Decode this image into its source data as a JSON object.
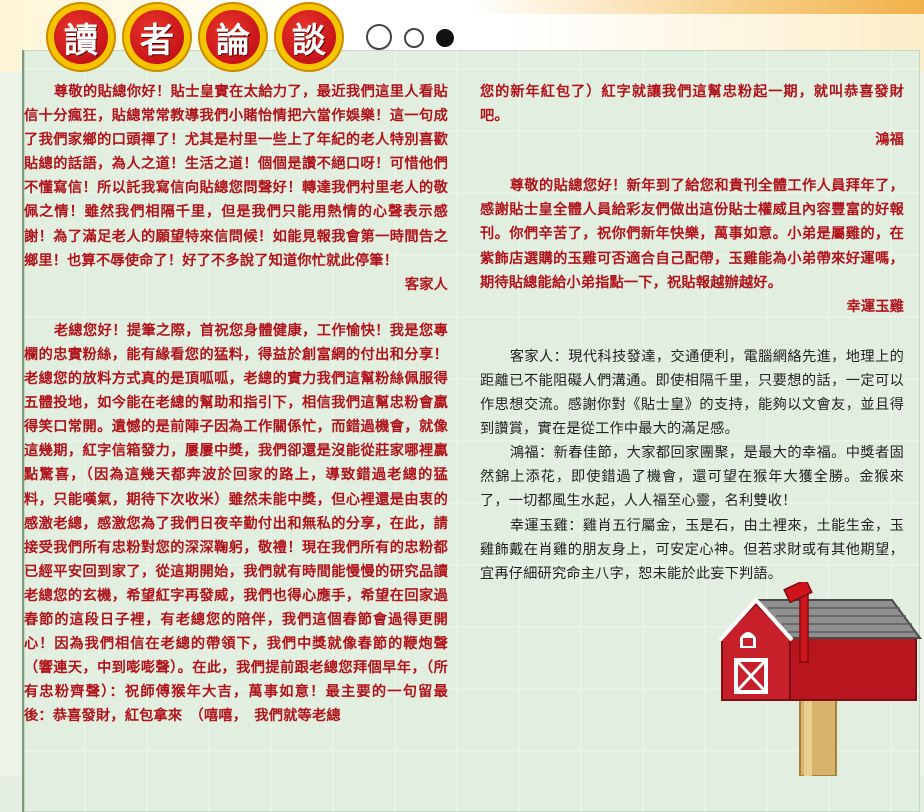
{
  "header": {
    "title_chars": [
      "讀",
      "者",
      "論",
      "談"
    ]
  },
  "colors": {
    "letter_text": "#b0141a",
    "reply_text": "#222222",
    "badge_red": "#c8141a",
    "badge_ring": "#f5c400",
    "background": "#e2efe0"
  },
  "letters_left": {
    "letter1": {
      "text": "尊敬的貼總你好！貼士皇實在太給力了，最近我們這里人看貼信十分瘋狂，貼總常常教導我們小賭怡情把六當作娛樂！這一句成了我們家鄉的口頭禪了！尤其是村里一些上了年紀的老人特別喜歡貼總的話語，為人之道！生活之道！個個是讚不絕口呀！可惜他們不懂寫信！所以託我寫信向貼總您問聲好！轉達我們村里老人的敬佩之情！雖然我們相隔千里，但是我們只能用熱情的心聲表示感謝！為了滿足老人的願望特來信問候！如能見報我會第一時間告之鄉里！也算不辱使命了！好了不多說了知道你忙就此停筆！",
      "signature": "客家人"
    },
    "letter2": {
      "text": "老總您好！提筆之際，首祝您身體健康，工作愉快！我是您專欄的忠實粉絲，能有緣看您的猛料，得益於創富網的付出和分享！老總您的放料方式真的是頂呱呱，老總的實力我們這幫粉絲佩服得五體投地，如今能在老總的幫助和指引下，相信我們這幫忠粉會贏得笑口常開。遺憾的是前陣子因為工作關係忙，而錯過機會，就像這幾期，紅字信箱發力，屢屢中獎，我們卻還是沒能從莊家哪裡贏點驚喜，（因為這幾天都奔波於回家的路上，導致錯過老總的猛料，只能嘆氣，期待下次收米）雖然未能中獎，但心裡還是由衷的感激老總，感激您為了我們日夜辛勤付出和無私的分享，在此，請接受我們所有忠粉對您的深深鞠躬，敬禮！現在我們所有的忠粉都已經平安回到家了，從這期開始，我們就有時間能慢慢的研究品讀老總您的玄機，希望紅字再發威，我們也得心應手，希望在回家過春節的這段日子裡，有老總您的陪伴，我們這個春節會過得更開心！因為我們相信在老總的帶領下，我們中獎就像春節的鞭炮聲（響連天，中到嘭嘭聲）。在此，我們提前跟老總您拜個早年，（所有忠粉齊聲）：祝師傅猴年大吉，萬事如意！最主要的一句留最後：恭喜發財，紅包拿來　（嘻嘻，　我們就等老總"
    }
  },
  "letters_right": {
    "letter2_continued": "您的新年紅包了）紅字就讓我們這幫忠粉起一期，就叫恭喜發財吧。",
    "letter2_signature": "鴻福",
    "letter3": {
      "text": "尊敬的貼總您好！新年到了給您和貴刊全體工作人員拜年了，感謝貼士皇全體人員給彩友們做出這份貼士權威且內容豐富的好報刊。你們辛苦了，祝你們新年快樂，萬事如意。小弟是屬雞的，在紫飾店選購的玉雞可否適合自己配帶，玉雞能為小弟帶來好運嗎，期待貼總能給小弟指點一下，祝貼報越辦越好。",
      "signature": "幸運玉雞"
    }
  },
  "replies": [
    "客家人：現代科技發達，交通便利，電腦網絡先進，地理上的距離已不能阻礙人們溝通。即使相隔千里，只要想的話，一定可以作思想交流。感謝你對《貼士皇》的支持，能夠以文會友，並且得到讚賞，實在是從工作中最大的滿足感。",
    "鴻福：新春佳節，大家都回家團聚，是最大的幸福。中獎者固然錦上添花，即使錯過了機會，還可望在猴年大獲全勝。金猴來了，一切都風生水起，人人福至心靈，名利雙收！",
    "幸運玉雞：雞肖五行屬金，玉是石，由土裡來，土能生金，玉雞飾戴在肖雞的朋友身上，可安定心神。但若求財或有其他期望，宜再仔細研究命主八字，恕未能於此妄下判語。"
  ],
  "icons": [
    "mailbox-icon",
    "decorative-dots"
  ]
}
